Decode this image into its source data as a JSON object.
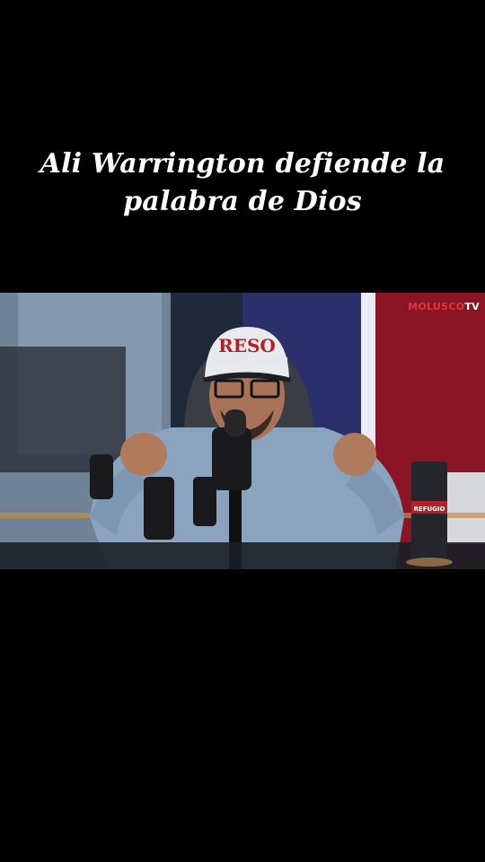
{
  "caption": {
    "line1": "Ali Warrington defiende la",
    "line2": "palabra de Dios"
  },
  "video": {
    "watermark_brand": "MOLUSCO",
    "watermark_suffix": "TV",
    "cap_text": "RESO",
    "cup_text": "REFUGIO",
    "accent_color": "#e2333f"
  }
}
